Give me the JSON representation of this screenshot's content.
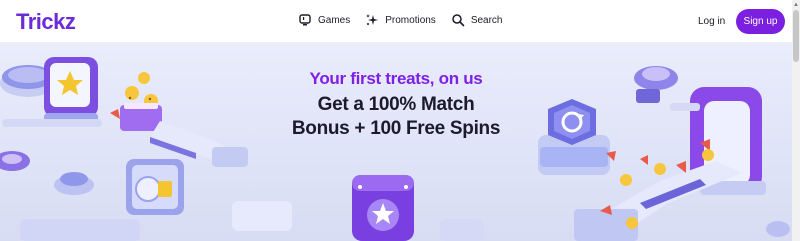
{
  "brand": {
    "name": "Trickz",
    "color": "#6c2bd9"
  },
  "nav": [
    {
      "label": "Games",
      "icon": "gamepad-icon"
    },
    {
      "label": "Promotions",
      "icon": "sparkle-icon"
    },
    {
      "label": "Search",
      "icon": "search-icon"
    }
  ],
  "auth": {
    "login_label": "Log in",
    "signup_label": "Sign up",
    "signup_color": "#7b1fe0"
  },
  "hero": {
    "tagline": "Your first treats, on us",
    "headline_line1": "Get a 100% Match",
    "headline_line2": "Bonus + 100 Free Spins",
    "accent_color": "#7e20e8"
  }
}
